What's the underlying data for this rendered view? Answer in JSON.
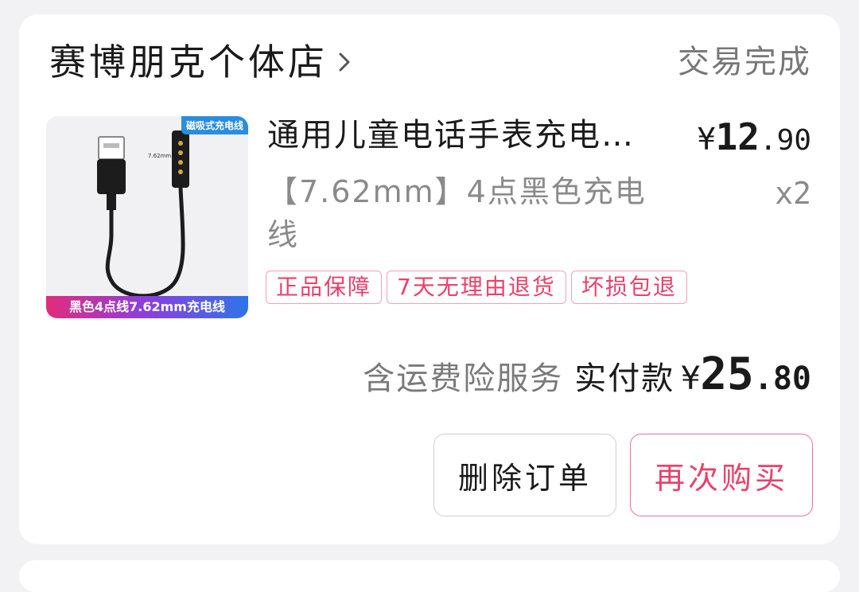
{
  "order": {
    "shop_name": "赛博朋克个体店",
    "status": "交易完成",
    "product": {
      "title": "通用儿童电话手表充电…",
      "price_symbol": "¥",
      "price_int": "12",
      "price_dec": ".90",
      "spec": "【7.62mm】4点黑色充电线",
      "qty": "x2",
      "thumb_tag": "磁吸式充电线",
      "thumb_banner": "黑色4点线7.62mm充电线",
      "tags": [
        "正品保障",
        "7天无理由退货",
        "坏损包退"
      ]
    },
    "total": {
      "note": "含运费险服务",
      "label": "实付款",
      "symbol": "¥",
      "int": "25",
      "dec": ".80"
    },
    "actions": {
      "delete_label": "删除订单",
      "rebuy_label": "再次购买"
    }
  },
  "colors": {
    "accent": "#e8416a",
    "background": "#f2f2f4",
    "card": "#ffffff"
  },
  "icons": {
    "shop_arrow": "chevron-right-icon"
  }
}
